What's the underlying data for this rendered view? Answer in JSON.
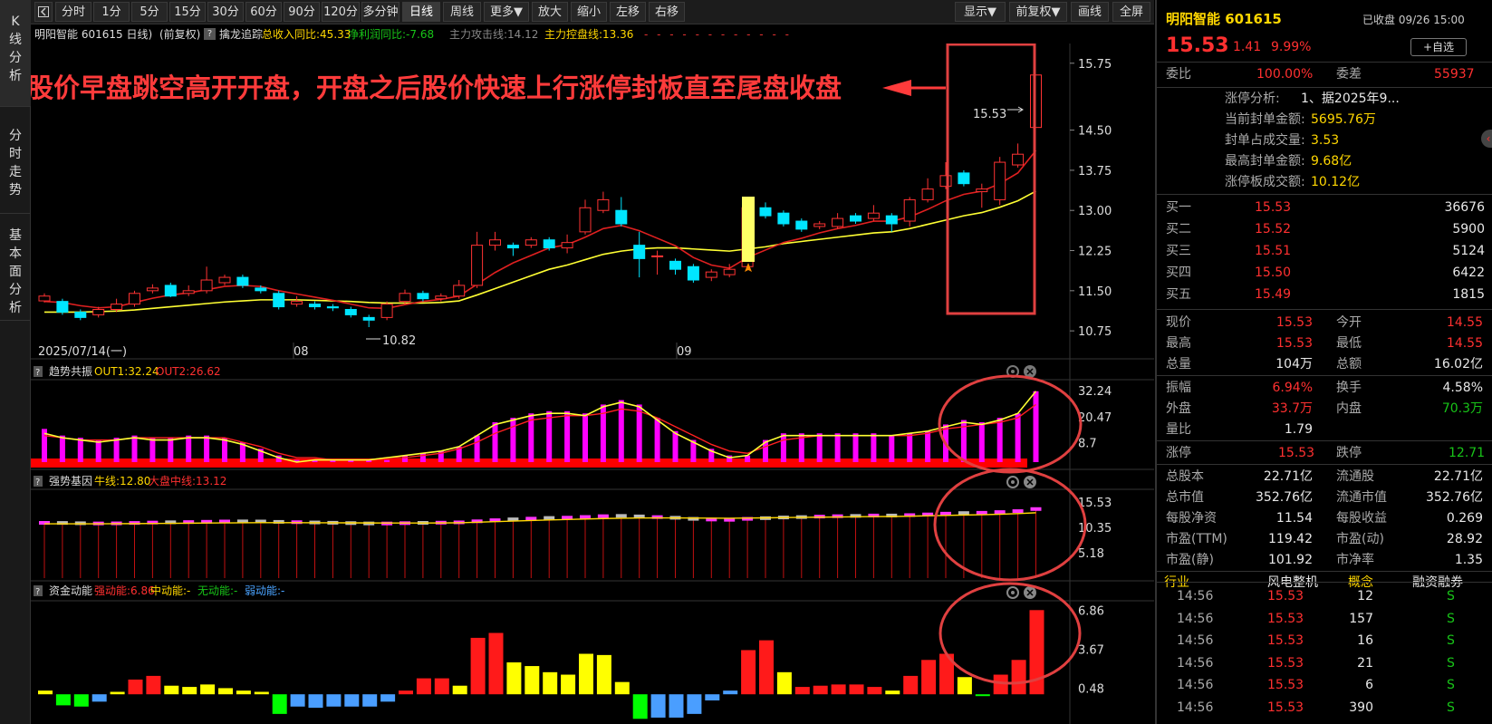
{
  "left_tabs": [
    "K线分析",
    "分时走势",
    "基本面分析"
  ],
  "toolbar": {
    "back_icon": "back-icon",
    "buttons": [
      "分时",
      "1分",
      "5分",
      "15分",
      "30分",
      "60分",
      "90分",
      "120分",
      "多分钟",
      "日线",
      "周线",
      "更多▼",
      "放大",
      "缩小",
      "左移",
      "右移"
    ],
    "active": "日线",
    "right_buttons": [
      "显示▼",
      "前复权▼",
      "画线",
      "全屏"
    ]
  },
  "header": {
    "stock": "明阳智能 601615 日线)",
    "mode": "(前复权)",
    "help": "?",
    "indicator": "擒龙追踪",
    "f1": "总收入同比:45.33",
    "f2": "净利润同比:-7.68",
    "f3": "主力攻击线:14.12",
    "f4": "主力控盘线:13.36"
  },
  "main_chart": {
    "annotation": "股价早盘跳空高开开盘，开盘之后股价快速上行涨停封板直至尾盘收盘",
    "y_ticks": [
      "15.75",
      "14.50",
      "13.75",
      "13.00",
      "12.25",
      "11.50",
      "10.75"
    ],
    "x_labels": [
      "2025/07/14(一)",
      "08",
      "09"
    ],
    "high_label": "15.53",
    "low_label": "10.82"
  },
  "chart_data": {
    "type": "candlestick",
    "title": "明阳智能 601615 日线",
    "y_ticks": [
      15.75,
      14.5,
      13.75,
      13.0,
      12.25,
      11.5,
      10.75
    ],
    "ylim": [
      10.6,
      16.0
    ],
    "candles": [
      {
        "o": 11.31,
        "c": 11.4,
        "h": 11.45,
        "l": 11.28
      },
      {
        "o": 11.3,
        "c": 11.1,
        "h": 11.35,
        "l": 11.05
      },
      {
        "o": 11.1,
        "c": 11.0,
        "h": 11.15,
        "l": 10.95
      },
      {
        "o": 11.05,
        "c": 11.15,
        "h": 11.2,
        "l": 11.0
      },
      {
        "o": 11.15,
        "c": 11.25,
        "h": 11.35,
        "l": 11.1
      },
      {
        "o": 11.25,
        "c": 11.45,
        "h": 11.5,
        "l": 11.2
      },
      {
        "o": 11.5,
        "c": 11.55,
        "h": 11.62,
        "l": 11.45
      },
      {
        "o": 11.6,
        "c": 11.4,
        "h": 11.65,
        "l": 11.38
      },
      {
        "o": 11.45,
        "c": 11.5,
        "h": 11.6,
        "l": 11.4
      },
      {
        "o": 11.5,
        "c": 11.7,
        "h": 11.95,
        "l": 11.45
      },
      {
        "o": 11.65,
        "c": 11.75,
        "h": 11.8,
        "l": 11.6
      },
      {
        "o": 11.75,
        "c": 11.6,
        "h": 11.8,
        "l": 11.55
      },
      {
        "o": 11.55,
        "c": 11.5,
        "h": 11.6,
        "l": 11.45
      },
      {
        "o": 11.45,
        "c": 11.2,
        "h": 11.5,
        "l": 11.15
      },
      {
        "o": 11.25,
        "c": 11.3,
        "h": 11.4,
        "l": 11.2
      },
      {
        "o": 11.25,
        "c": 11.2,
        "h": 11.3,
        "l": 11.15
      },
      {
        "o": 11.2,
        "c": 11.18,
        "h": 11.25,
        "l": 11.12
      },
      {
        "o": 11.15,
        "c": 11.05,
        "h": 11.2,
        "l": 11.0
      },
      {
        "o": 11.0,
        "c": 10.95,
        "h": 11.05,
        "l": 10.82
      },
      {
        "o": 11.0,
        "c": 11.25,
        "h": 11.3,
        "l": 10.95
      },
      {
        "o": 11.3,
        "c": 11.45,
        "h": 11.52,
        "l": 11.25
      },
      {
        "o": 11.45,
        "c": 11.35,
        "h": 11.5,
        "l": 11.3
      },
      {
        "o": 11.35,
        "c": 11.4,
        "h": 11.45,
        "l": 11.3
      },
      {
        "o": 11.4,
        "c": 11.6,
        "h": 11.7,
        "l": 11.35
      },
      {
        "o": 11.6,
        "c": 12.35,
        "h": 12.6,
        "l": 11.55
      },
      {
        "o": 12.35,
        "c": 12.45,
        "h": 12.6,
        "l": 12.25
      },
      {
        "o": 12.35,
        "c": 12.3,
        "h": 12.4,
        "l": 12.15
      },
      {
        "o": 12.35,
        "c": 12.45,
        "h": 12.5,
        "l": 12.3
      },
      {
        "o": 12.45,
        "c": 12.3,
        "h": 12.5,
        "l": 12.25
      },
      {
        "o": 12.3,
        "c": 12.4,
        "h": 12.55,
        "l": 12.2
      },
      {
        "o": 12.6,
        "c": 13.05,
        "h": 13.2,
        "l": 12.55
      },
      {
        "o": 13.0,
        "c": 13.2,
        "h": 13.35,
        "l": 12.95
      },
      {
        "o": 13.0,
        "c": 12.75,
        "h": 13.25,
        "l": 12.7
      },
      {
        "o": 12.35,
        "c": 12.1,
        "h": 12.6,
        "l": 11.75
      },
      {
        "o": 12.15,
        "c": 12.15,
        "h": 12.25,
        "l": 11.8
      },
      {
        "o": 12.05,
        "c": 11.9,
        "h": 12.1,
        "l": 11.8
      },
      {
        "o": 11.95,
        "c": 11.7,
        "h": 12.0,
        "l": 11.65
      },
      {
        "o": 11.75,
        "c": 11.85,
        "h": 11.9,
        "l": 11.68
      },
      {
        "o": 11.8,
        "c": 11.9,
        "h": 12.0,
        "l": 11.75
      },
      {
        "o": 11.95,
        "c": 13.05,
        "h": 13.05,
        "l": 11.95
      },
      {
        "o": 13.05,
        "c": 12.9,
        "h": 13.15,
        "l": 12.85
      },
      {
        "o": 12.95,
        "c": 12.75,
        "h": 13.0,
        "l": 12.7
      },
      {
        "o": 12.8,
        "c": 12.65,
        "h": 12.85,
        "l": 12.6
      },
      {
        "o": 12.7,
        "c": 12.75,
        "h": 12.8,
        "l": 12.65
      },
      {
        "o": 12.7,
        "c": 12.85,
        "h": 12.95,
        "l": 12.65
      },
      {
        "o": 12.9,
        "c": 12.8,
        "h": 12.95,
        "l": 12.75
      },
      {
        "o": 12.85,
        "c": 12.95,
        "h": 13.1,
        "l": 12.8
      },
      {
        "o": 12.9,
        "c": 12.75,
        "h": 12.95,
        "l": 12.6
      },
      {
        "o": 12.8,
        "c": 13.2,
        "h": 13.25,
        "l": 12.7
      },
      {
        "o": 13.2,
        "c": 13.4,
        "h": 13.6,
        "l": 13.15
      },
      {
        "o": 13.45,
        "c": 13.65,
        "h": 13.9,
        "l": 13.4
      },
      {
        "o": 13.7,
        "c": 13.5,
        "h": 13.75,
        "l": 13.45
      },
      {
        "o": 13.35,
        "c": 13.4,
        "h": 13.5,
        "l": 13.05
      },
      {
        "o": 13.2,
        "c": 13.9,
        "h": 14.0,
        "l": 13.1
      },
      {
        "o": 13.85,
        "c": 14.05,
        "h": 14.25,
        "l": 13.8
      },
      {
        "o": 14.55,
        "c": 15.53,
        "h": 15.53,
        "l": 14.55
      }
    ],
    "ma_short": [
      11.3,
      11.28,
      11.22,
      11.18,
      11.2,
      11.28,
      11.36,
      11.42,
      11.46,
      11.52,
      11.58,
      11.6,
      11.58,
      11.5,
      11.44,
      11.38,
      11.32,
      11.25,
      11.18,
      11.17,
      11.24,
      11.3,
      11.34,
      11.4,
      11.62,
      11.84,
      12.02,
      12.16,
      12.3,
      12.36,
      12.5,
      12.66,
      12.72,
      12.62,
      12.48,
      12.34,
      12.12,
      11.98,
      11.92,
      12.12,
      12.26,
      12.4,
      12.48,
      12.58,
      12.66,
      12.72,
      12.8,
      12.8,
      12.88,
      13.02,
      13.18,
      13.3,
      13.36,
      13.5,
      13.7,
      14.12
    ],
    "ma_long": [
      11.1,
      11.1,
      11.1,
      11.11,
      11.12,
      11.14,
      11.17,
      11.2,
      11.23,
      11.26,
      11.29,
      11.31,
      11.33,
      11.33,
      11.33,
      11.32,
      11.31,
      11.3,
      11.28,
      11.27,
      11.27,
      11.27,
      11.28,
      11.31,
      11.42,
      11.54,
      11.66,
      11.78,
      11.9,
      11.98,
      12.08,
      12.18,
      12.24,
      12.28,
      12.3,
      12.3,
      12.28,
      12.26,
      12.24,
      12.28,
      12.32,
      12.38,
      12.42,
      12.46,
      12.5,
      12.54,
      12.58,
      12.6,
      12.66,
      12.74,
      12.82,
      12.9,
      12.96,
      13.06,
      13.18,
      13.36
    ],
    "sub1": {
      "name": "趋势共振",
      "out1_label": "OUT1:32.24",
      "out2_label": "OUT2:26.62",
      "y_ticks": [
        32.24,
        20.47,
        8.7
      ],
      "ylim": [
        0,
        36
      ],
      "bars": [
        15,
        12,
        11,
        10,
        11,
        12,
        11,
        11,
        12,
        12,
        11,
        9,
        6,
        3,
        1,
        1,
        1,
        1,
        1,
        1,
        3,
        4,
        5,
        7,
        12,
        18,
        20,
        22,
        23,
        23,
        22,
        26,
        28,
        26,
        20,
        14,
        10,
        6,
        3,
        3,
        10,
        13,
        13,
        13,
        13,
        13,
        13,
        12,
        13,
        14,
        17,
        19,
        18,
        20,
        22,
        32
      ],
      "out1": [
        13,
        11,
        10,
        9,
        10,
        11,
        10,
        10,
        11,
        11,
        10,
        8,
        5,
        2,
        0,
        1,
        1,
        1,
        1,
        2,
        3,
        4,
        5,
        7,
        12,
        17,
        19,
        21,
        22,
        22,
        21,
        25,
        27,
        25,
        19,
        13,
        9,
        5,
        2,
        3,
        9,
        12,
        12,
        12,
        12,
        12,
        12,
        12,
        13,
        14,
        16,
        18,
        17,
        19,
        22,
        32
      ],
      "out2": [
        12,
        11,
        10,
        10,
        10,
        11,
        11,
        11,
        11,
        11,
        11,
        9,
        7,
        4,
        2,
        2,
        1,
        1,
        1,
        2,
        2,
        3,
        4,
        6,
        9,
        13,
        16,
        19,
        20,
        21,
        21,
        22,
        24,
        23,
        20,
        16,
        12,
        8,
        5,
        4,
        7,
        10,
        11,
        12,
        12,
        12,
        12,
        12,
        12,
        13,
        15,
        16,
        17,
        18,
        20,
        26
      ]
    },
    "sub2": {
      "name": "强势基因",
      "bull_label": "牛线:12.80",
      "mid_label": "大盘中线:13.12",
      "y_ticks": [
        15.53,
        10.35,
        5.18
      ],
      "ylim": [
        0,
        17.6
      ]
    },
    "sub3": {
      "name": "资金动能",
      "strong_label": "强动能:6.86",
      "mid_label": "中动能:-",
      "none_label": "无动能:-",
      "weak_label": "弱动能:-",
      "y_ticks": [
        6.86,
        3.67,
        0.48
      ],
      "ylim": [
        -2.2,
        7.4
      ],
      "bars": [
        0.3,
        -0.9,
        -1.0,
        -0.6,
        0.2,
        1.2,
        1.5,
        0.7,
        0.6,
        0.8,
        0.5,
        0.3,
        0.2,
        -1.6,
        -1.0,
        -1.1,
        -1.0,
        -1.0,
        -1.0,
        -0.6,
        0.3,
        1.3,
        1.3,
        0.7,
        4.6,
        5.0,
        2.6,
        2.3,
        1.8,
        1.6,
        3.3,
        3.2,
        1.0,
        -2.0,
        -1.9,
        -1.9,
        -1.6,
        -0.5,
        0.3,
        3.6,
        4.4,
        1.8,
        0.6,
        0.7,
        0.8,
        0.8,
        0.6,
        0.3,
        1.5,
        2.8,
        3.3,
        1.4,
        -0.1,
        1.6,
        2.8,
        6.86
      ],
      "types": [
        "y",
        "g",
        "g",
        "b",
        "y",
        "r",
        "r",
        "y",
        "y",
        "y",
        "y",
        "y",
        "y",
        "g",
        "b",
        "b",
        "b",
        "b",
        "b",
        "b",
        "r",
        "r",
        "r",
        "y",
        "r",
        "r",
        "y",
        "y",
        "y",
        "y",
        "y",
        "y",
        "y",
        "g",
        "b",
        "b",
        "b",
        "b",
        "b",
        "r",
        "r",
        "y",
        "r",
        "r",
        "r",
        "r",
        "r",
        "y",
        "r",
        "r",
        "r",
        "y",
        "g",
        "r",
        "r",
        "r"
      ]
    }
  },
  "subpanels": {
    "sub1_help": "?",
    "sub2_help": "?",
    "sub3_help": "?"
  },
  "right_panel": {
    "name": "明阳智能 601615",
    "status": "已收盘 09/26 15:00",
    "price": "15.53",
    "change": "1.41",
    "pct": "9.99%",
    "watch_btn": "+自选",
    "weibi_label": "委比",
    "weibi": "100.00%",
    "weicha_label": "委差",
    "weicha": "55937",
    "limit_info": [
      {
        "k": "涨停分析:",
        "v": "1、据2025年9..."
      },
      {
        "k": "当前封单金额:",
        "v": "5695.76万"
      },
      {
        "k": "封单占成交量:",
        "v": "3.53"
      },
      {
        "k": "最高封单金额:",
        "v": "9.68亿"
      },
      {
        "k": "涨停板成交额:",
        "v": "10.12亿"
      }
    ],
    "bids": [
      {
        "label": "买一",
        "price": "15.53",
        "vol": "36676"
      },
      {
        "label": "买二",
        "price": "15.52",
        "vol": "5900"
      },
      {
        "label": "买三",
        "price": "15.51",
        "vol": "5124"
      },
      {
        "label": "买四",
        "price": "15.50",
        "vol": "6422"
      },
      {
        "label": "买五",
        "price": "15.49",
        "vol": "1815"
      }
    ],
    "stats1": [
      {
        "k1": "现价",
        "v1": "15.53",
        "k2": "今开",
        "v2": "14.55"
      },
      {
        "k1": "最高",
        "v1": "15.53",
        "k2": "最低",
        "v2": "14.55"
      },
      {
        "k1": "总量",
        "v1": "104万",
        "k2": "总额",
        "v2": "16.02亿"
      }
    ],
    "stats2": [
      {
        "k1": "振幅",
        "v1": "6.94%",
        "k2": "换手",
        "v2": "4.58%"
      },
      {
        "k1": "外盘",
        "v1": "33.7万",
        "k2": "内盘",
        "v2": "70.3万"
      },
      {
        "k1": "量比",
        "v1": "1.79",
        "k2": "",
        "v2": ""
      }
    ],
    "limits": {
      "k1": "涨停",
      "v1": "15.53",
      "k2": "跌停",
      "v2": "12.71"
    },
    "stats3": [
      {
        "k1": "总股本",
        "v1": "22.71亿",
        "k2": "流通股",
        "v2": "22.71亿"
      },
      {
        "k1": "总市值",
        "v1": "352.76亿",
        "k2": "流通市值",
        "v2": "352.76亿"
      },
      {
        "k1": "每股净资",
        "v1": "11.54",
        "k2": "每股收益",
        "v2": "0.269"
      },
      {
        "k1": "市盈(TTM)",
        "v1": "119.42",
        "k2": "市盈(动)",
        "v2": "28.92"
      },
      {
        "k1": "市盈(静)",
        "v1": "101.92",
        "k2": "市净率",
        "v2": "1.35"
      }
    ],
    "tags": {
      "industry_label": "行业",
      "industry": "风电整机",
      "concept": "概念",
      "margin": "融资融券"
    },
    "ticks": [
      {
        "time": "14:56",
        "price": "15.53",
        "vol": "12",
        "side": "S"
      },
      {
        "time": "14:56",
        "price": "15.53",
        "vol": "157",
        "side": "S"
      },
      {
        "time": "14:56",
        "price": "15.53",
        "vol": "16",
        "side": "S"
      },
      {
        "time": "14:56",
        "price": "15.53",
        "vol": "21",
        "side": "S"
      },
      {
        "time": "14:56",
        "price": "15.53",
        "vol": "6",
        "side": "S"
      },
      {
        "time": "14:56",
        "price": "15.53",
        "vol": "390",
        "side": "S"
      }
    ]
  },
  "colors": {
    "up": "#ff3333",
    "down": "#00e5ff",
    "ma_short": "#e02020",
    "ma_long": "#ffff33",
    "magenta": "#ff00ff",
    "annotation": "#ff3b3b",
    "highlight": "#e04040"
  }
}
